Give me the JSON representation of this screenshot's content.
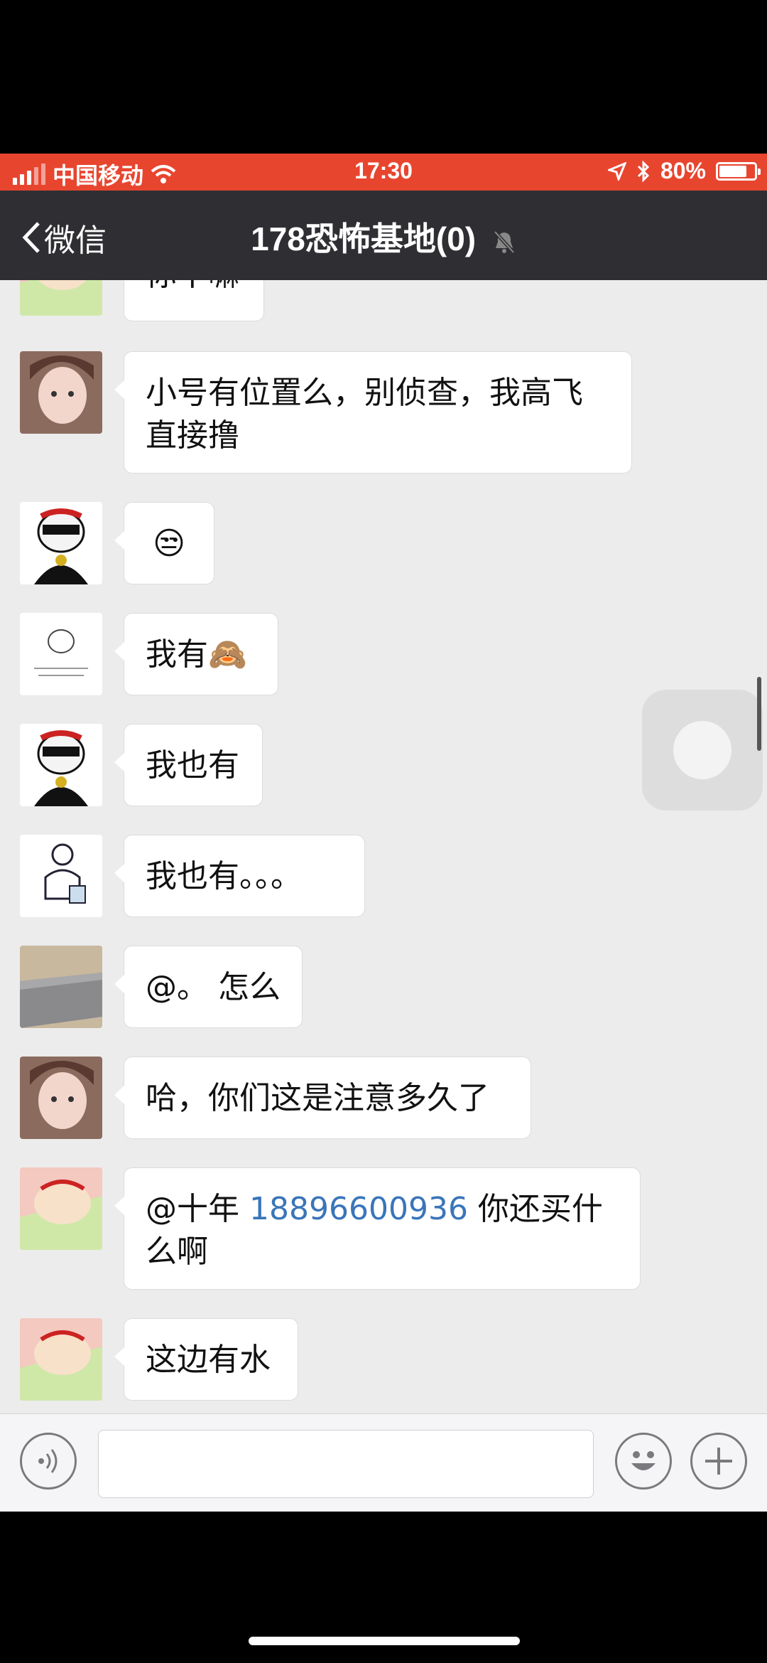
{
  "status_bar": {
    "carrier": "中国移动",
    "time": "17:30",
    "battery": "80%",
    "battery_level": 0.8
  },
  "nav": {
    "back_label": "微信",
    "title": "178恐怖基地(0)"
  },
  "messages": [
    {
      "avatar": "shinchan-avatar",
      "text": "你干嘛"
    },
    {
      "avatar": "girl-avatar",
      "text": "小号有位置么，别侦查，我高飞\n直接撸"
    },
    {
      "avatar": "panda-avatar",
      "text": "😒"
    },
    {
      "avatar": "pig-sketch-avatar",
      "text": "我有🙈"
    },
    {
      "avatar": "panda-avatar",
      "text": "我也有"
    },
    {
      "avatar": "sketch-man-avatar",
      "text": "我也有。。。"
    },
    {
      "avatar": "bed-photo-avatar",
      "text": "@。 怎么"
    },
    {
      "avatar": "girl-avatar",
      "text": "哈，你们这是注意多久了"
    },
    {
      "avatar": "shinchan-avatar",
      "mention": "@十年 ",
      "phone": "18896600936",
      "text_after": " 你还买什么\n么啊",
      "text_line1_after": " 你还买什",
      "text_line2": "么啊"
    },
    {
      "avatar": "shinchan-avatar",
      "text": "这边有水"
    }
  ],
  "colors": {
    "status_bar": "#e8452f",
    "nav_bar": "#2f2f33",
    "chat_bg": "#ececec",
    "link": "#3a75b9"
  }
}
